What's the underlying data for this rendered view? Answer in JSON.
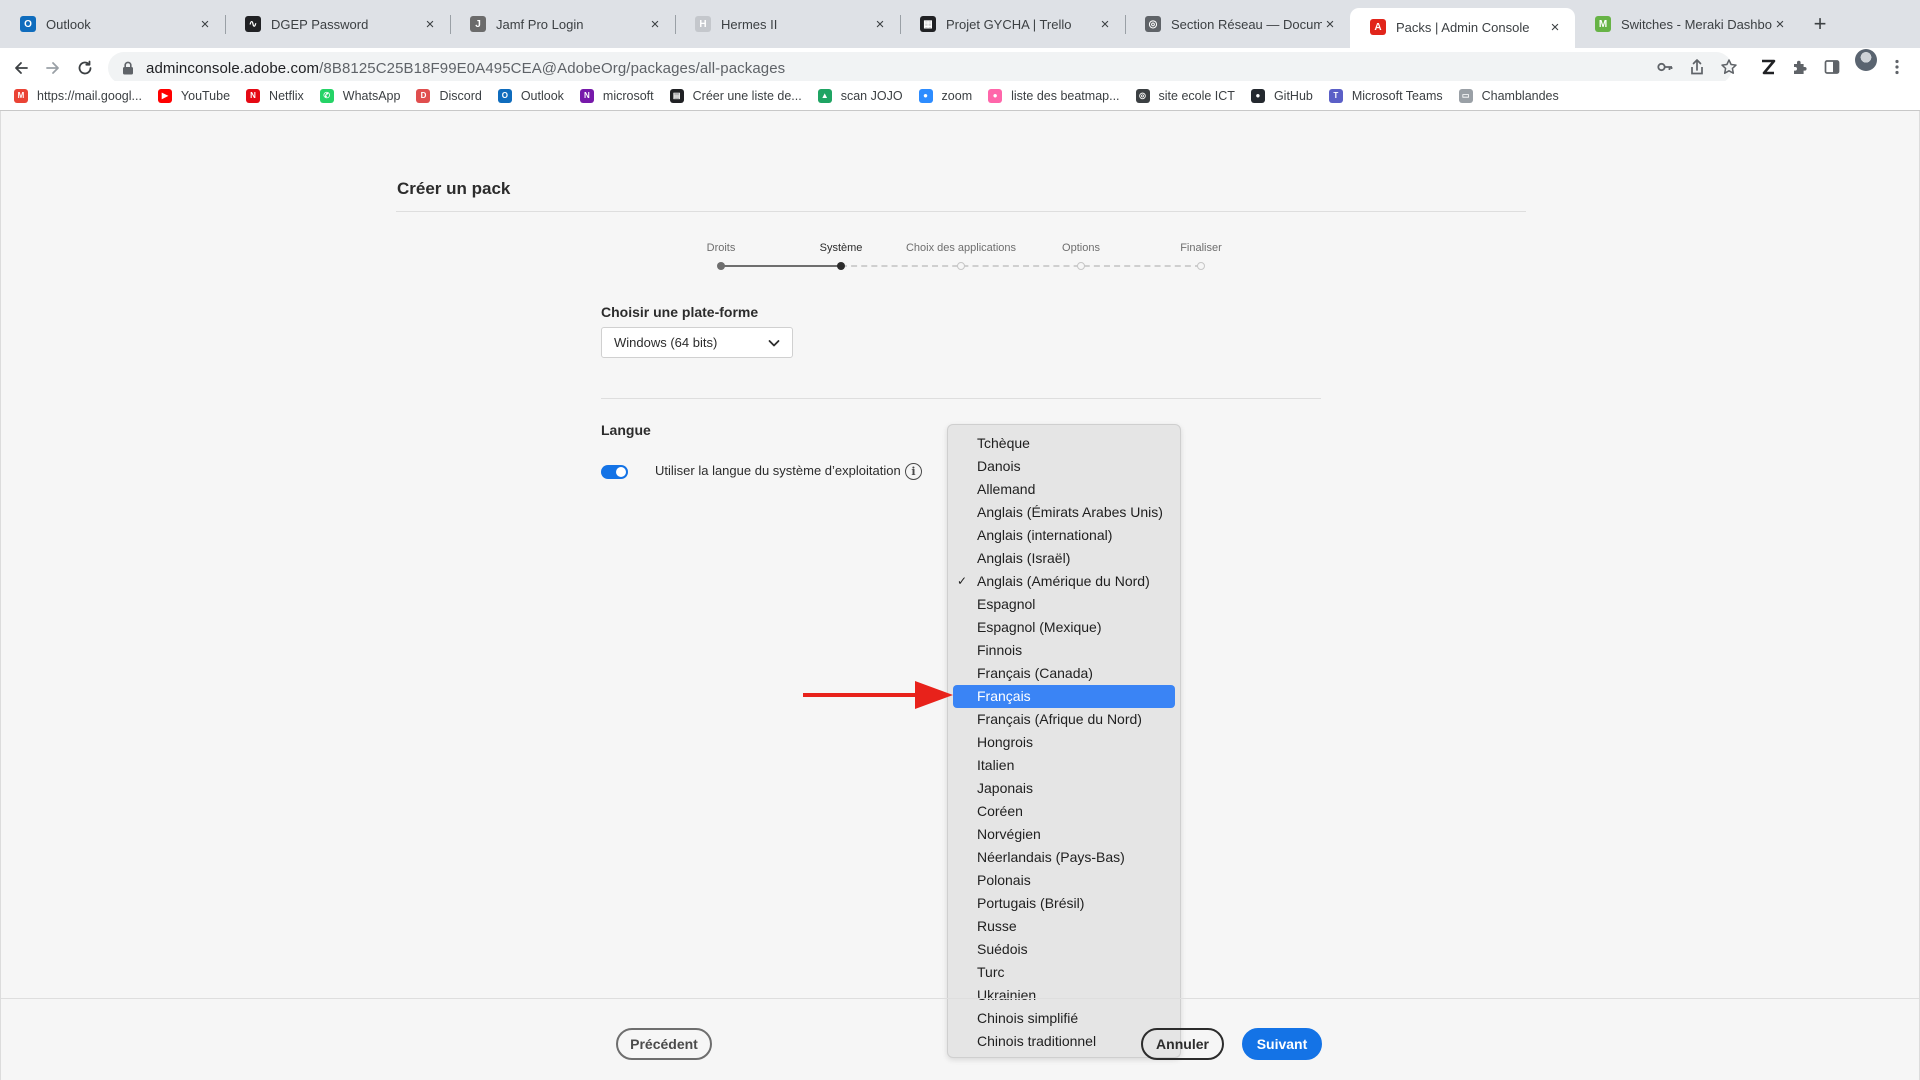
{
  "browser": {
    "tabs": [
      {
        "title": "Outlook",
        "icon": "outlook-icon"
      },
      {
        "title": "DGEP Password",
        "icon": "pulse-icon"
      },
      {
        "title": "Jamf Pro Login",
        "icon": "jamf-icon"
      },
      {
        "title": "Hermes II",
        "icon": "hermes-icon"
      },
      {
        "title": "Projet GYCHA | Trello",
        "icon": "trello-icon"
      },
      {
        "title": "Section Réseau — Documen",
        "icon": "globe-icon"
      },
      {
        "title": "Packs | Admin Console",
        "icon": "adobe-icon"
      },
      {
        "title": "Switches - Meraki Dashboa",
        "icon": "meraki-icon"
      }
    ],
    "active_tab": 6,
    "url_host": "adminconsole.adobe.com",
    "url_path": "/8B8125C25B18F99E0A495CEA@AdobeOrg/packages/all-packages",
    "bookmarks": [
      {
        "label": "https://mail.googl...",
        "icon": "gmail-icon"
      },
      {
        "label": "YouTube",
        "icon": "youtube-icon"
      },
      {
        "label": "Netflix",
        "icon": "netflix-icon"
      },
      {
        "label": "WhatsApp",
        "icon": "whatsapp-icon"
      },
      {
        "label": "Discord",
        "icon": "discord-icon"
      },
      {
        "label": "Outlook",
        "icon": "outlook-icon"
      },
      {
        "label": "microsoft",
        "icon": "onenote-icon"
      },
      {
        "label": "Créer une liste de...",
        "icon": "list-icon"
      },
      {
        "label": "scan JOJO",
        "icon": "drive-icon"
      },
      {
        "label": "zoom",
        "icon": "zoom-icon"
      },
      {
        "label": "liste des beatmap...",
        "icon": "osu-icon"
      },
      {
        "label": "site ecole ICT",
        "icon": "globe-icon"
      },
      {
        "label": "GitHub",
        "icon": "github-icon"
      },
      {
        "label": "Microsoft Teams",
        "icon": "teams-icon"
      },
      {
        "label": "Chamblandes",
        "icon": "folder-icon"
      }
    ]
  },
  "page": {
    "title": "Créer un pack",
    "steps": [
      {
        "label": "Droits",
        "state": "done"
      },
      {
        "label": "Système",
        "state": "current"
      },
      {
        "label": "Choix des applications",
        "state": "todo"
      },
      {
        "label": "Options",
        "state": "todo"
      },
      {
        "label": "Finaliser",
        "state": "todo"
      }
    ],
    "platform_label": "Choisir une plate-forme",
    "platform_value": "Windows (64 bits)",
    "language_label": "Langue",
    "toggle_label": "Utiliser la langue du système d’exploitation",
    "toggle_on": true,
    "info_glyph": "i"
  },
  "dropdown": {
    "checked_index": 6,
    "highlighted_index": 11,
    "check_glyph": "✓",
    "items": [
      "Tchèque",
      "Danois",
      "Allemand",
      "Anglais (Émirats Arabes Unis)",
      "Anglais (international)",
      "Anglais (Israël)",
      "Anglais (Amérique du Nord)",
      "Espagnol",
      "Espagnol (Mexique)",
      "Finnois",
      "Français (Canada)",
      "Français",
      "Français (Afrique du Nord)",
      "Hongrois",
      "Italien",
      "Japonais",
      "Coréen",
      "Norvégien",
      "Néerlandais (Pays-Bas)",
      "Polonais",
      "Portugais (Brésil)",
      "Russe",
      "Suédois",
      "Turc",
      "Ukrainien",
      "Chinois simplifié",
      "Chinois traditionnel"
    ]
  },
  "footer": {
    "previous": "Précédent",
    "cancel": "Annuler",
    "next": "Suivant"
  },
  "colors": {
    "accent": "#1473e6",
    "highlight": "#3a84f5",
    "annotation_arrow": "#e8221b"
  }
}
